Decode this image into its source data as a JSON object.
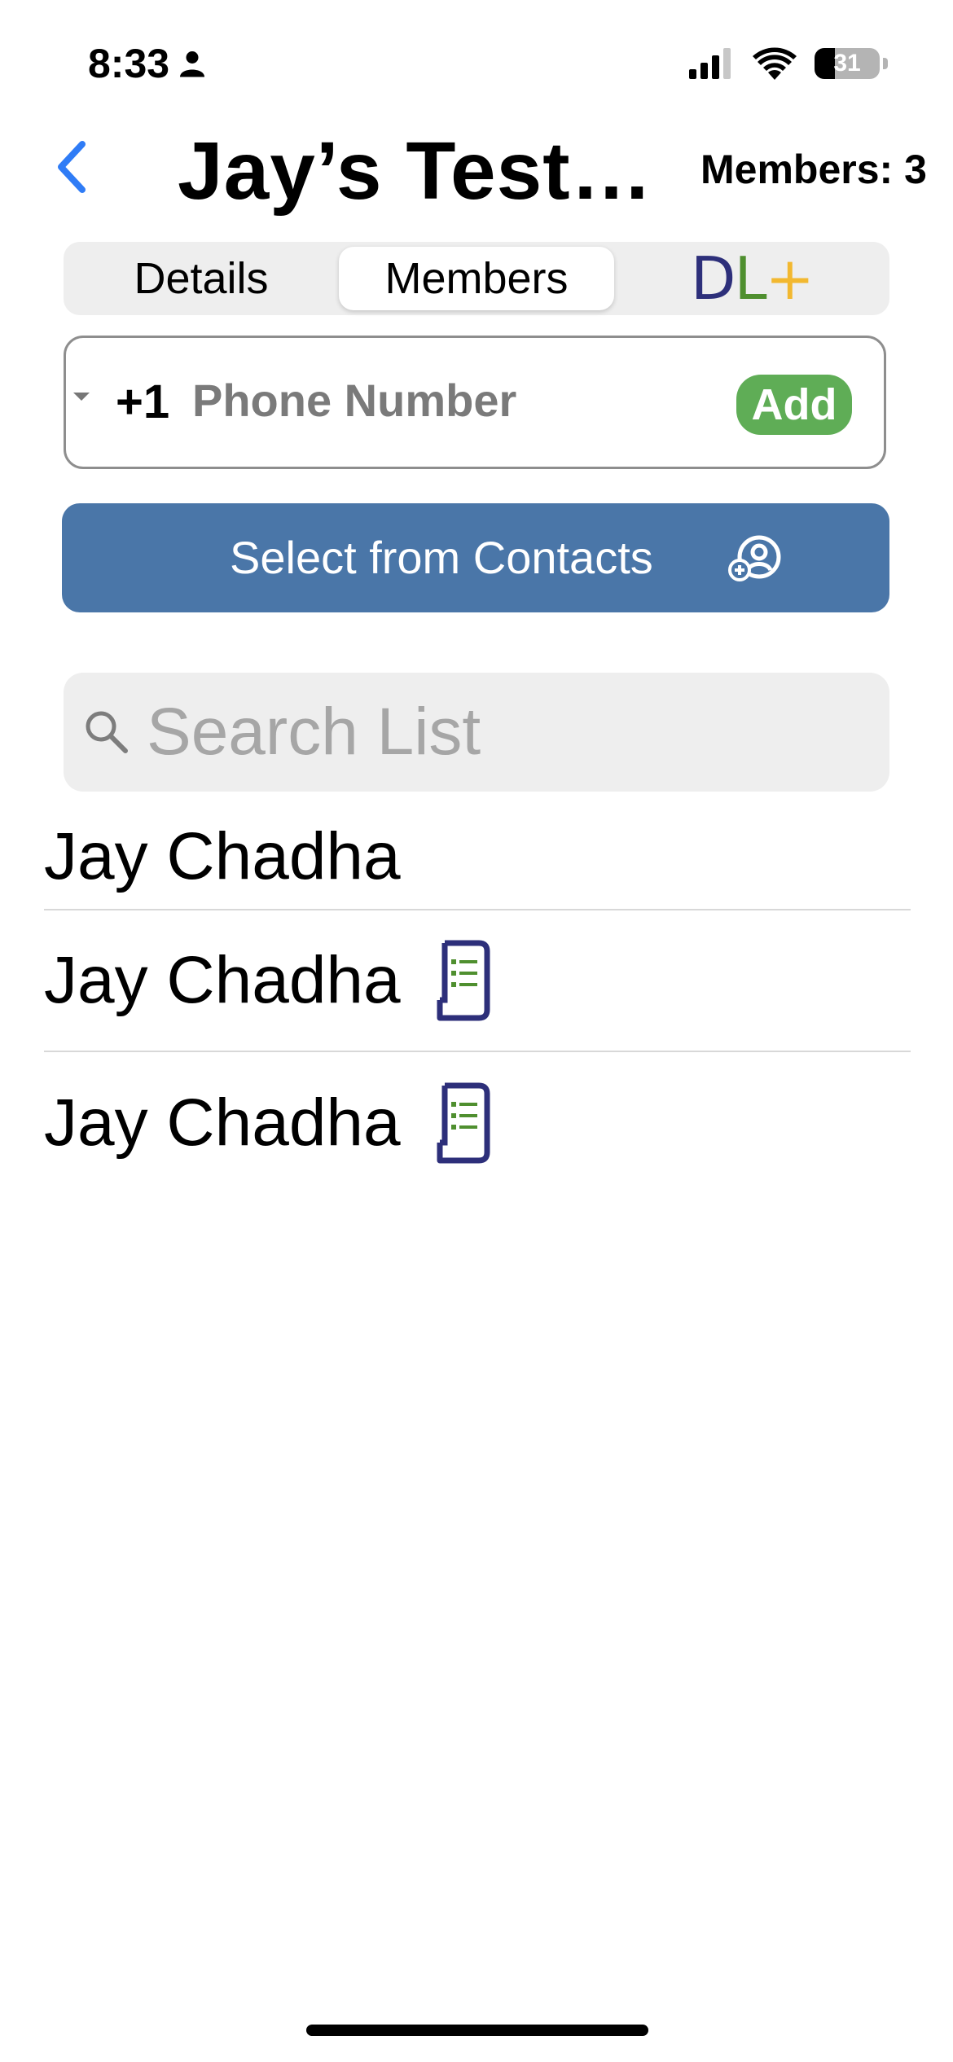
{
  "status_bar": {
    "time": "8:33",
    "battery_level": "31",
    "icons": [
      "person-icon",
      "cellular-signal-icon",
      "wifi-icon",
      "battery-icon"
    ]
  },
  "header": {
    "back_icon": "chevron-left-icon",
    "title": "Jay’s Test…",
    "members_count": "Members: 3"
  },
  "tabs": [
    {
      "label": "Details",
      "selected": false
    },
    {
      "label": "Members",
      "selected": true
    },
    {
      "label": "DL+",
      "selected": false
    }
  ],
  "logo": {
    "d": "D",
    "l": "L",
    "plus": "+",
    "colors": {
      "d": "#2d2f7a",
      "l": "#4f8f2f",
      "plus": "#f2b830"
    }
  },
  "phone_entry": {
    "country_code": "+1",
    "placeholder": "Phone Number",
    "value": "",
    "add_label": "Add"
  },
  "contacts_button": {
    "label": "Select from Contacts",
    "icon": "add-contact-icon"
  },
  "search": {
    "placeholder": "Search List",
    "value": ""
  },
  "members": [
    {
      "name": "Jay Chadha",
      "has_list_icon": false
    },
    {
      "name": "Jay Chadha",
      "has_list_icon": true
    },
    {
      "name": "Jay Chadha",
      "has_list_icon": true
    }
  ],
  "colors": {
    "accent_blue": "#2f7cf6",
    "contacts_button": "#4a76a8",
    "add_button": "#5fad56",
    "list_icon_frame": "#2d2f7a",
    "list_icon_lines": "#4f8f2f"
  }
}
